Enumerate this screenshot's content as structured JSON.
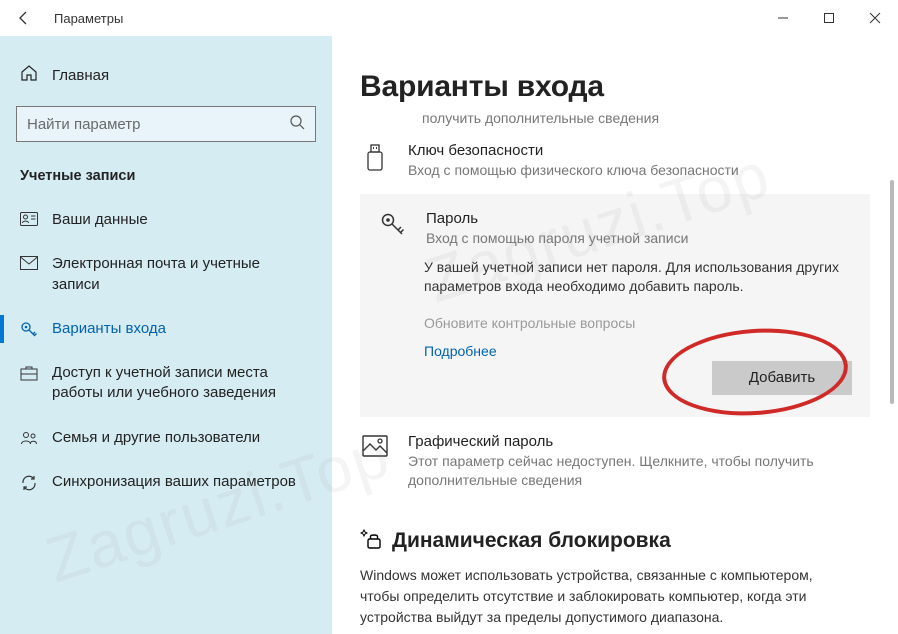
{
  "titlebar": {
    "title": "Параметры"
  },
  "sidebar": {
    "home_label": "Главная",
    "search_placeholder": "Найти параметр",
    "section_header": "Учетные записи",
    "items": [
      {
        "label": "Ваши данные"
      },
      {
        "label": "Электронная почта и учетные записи"
      },
      {
        "label": "Варианты входа"
      },
      {
        "label": "Доступ к учетной записи места работы или учебного заведения"
      },
      {
        "label": "Семья и другие пользователи"
      },
      {
        "label": "Синхронизация ваших параметров"
      }
    ]
  },
  "main": {
    "title": "Варианты входа",
    "subnote": "получить дополнительные сведения",
    "security_key": {
      "title": "Ключ безопасности",
      "desc": "Вход с помощью физического ключа безопасности"
    },
    "password": {
      "title": "Пароль",
      "desc": "Вход с помощью пароля учетной записи",
      "note": "У вашей учетной записи нет пароля. Для использования других параметров входа необходимо добавить пароль.",
      "update_questions": "Обновите контрольные вопросы",
      "learn_more": "Подробнее",
      "add_button": "Добавить"
    },
    "picture_password": {
      "title": "Графический пароль",
      "desc": "Этот параметр сейчас недоступен. Щелкните, чтобы получить дополнительные сведения"
    },
    "dynamic_lock": {
      "title": "Динамическая блокировка",
      "para": "Windows может использовать устройства, связанные с компьютером, чтобы определить отсутствие и заблокировать компьютер, когда эти устройства выйдут за пределы допустимого диапазона."
    }
  },
  "watermark": "Zagruzi.Top"
}
